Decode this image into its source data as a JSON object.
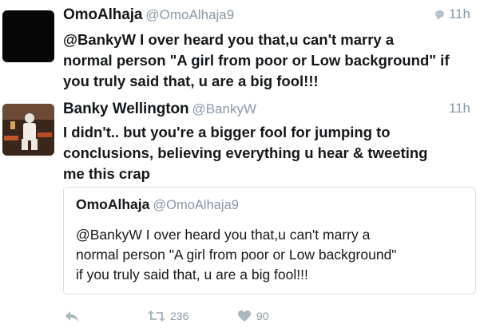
{
  "tweets": [
    {
      "display_name": "OmoAlhaja",
      "handle": "@OmoAlhaja9",
      "time": "11h",
      "avatar_icon": "black-avatar",
      "text": "@BankyW I over heard you that,u can't marry a\nnormal person \"A girl from poor or Low background\" if\nyou truly said that, u are a big fool!!!"
    },
    {
      "display_name": "Banky Wellington",
      "handle": "@BankyW",
      "time": "11h",
      "avatar_icon": "photo-avatar",
      "text": "I didn't.. but you're a bigger fool for jumping to\nconclusions, believing everything u hear & tweeting\nme this crap",
      "quote": {
        "display_name": "OmoAlhaja",
        "handle": "@OmoAlhaja9",
        "text": "@BankyW I over heard you that,u can't marry a\nnormal person \"A girl from poor or Low background\"\nif you truly said that, u are a big fool!!!"
      },
      "actions": {
        "reply_icon": "reply-icon",
        "retweet_icon": "retweet-icon",
        "retweet_count": "236",
        "like_icon": "heart-icon",
        "like_count": "90"
      }
    }
  ],
  "colors": {
    "text": "#14171a",
    "secondary": "#8899a6",
    "icon": "#aab8c2",
    "border": "#d8dee3"
  }
}
